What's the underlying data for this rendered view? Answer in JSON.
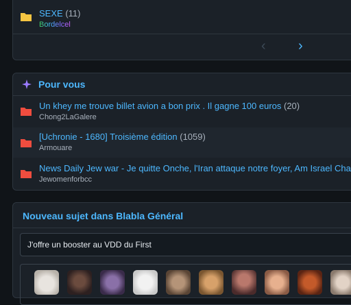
{
  "forum_list": {
    "last_item": {
      "title": "SEXE",
      "count": "(11)",
      "author": "Bordelcel"
    },
    "pager": {
      "prev_icon": "chevron-left-icon",
      "next_icon": "chevron-right-icon"
    }
  },
  "for_you": {
    "title": "Pour vous",
    "icon": "sparkle-icon",
    "topics": [
      {
        "title": "Un khey me trouve billet avion a bon prix . Il gagne 100 euros",
        "count": "(20)",
        "author": "Chong2LaGalere"
      },
      {
        "title": "[Uchronie - 1680] Troisième édition",
        "count": "(1059)",
        "author": "Armouare"
      },
      {
        "title": "News Daily Jew war - Je quitte Onche, l'Iran attaque notre foyer, Am Israel Chai -",
        "count": "",
        "author": "Jewomenforbcc"
      }
    ]
  },
  "new_topic": {
    "title": "Nouveau sujet dans Blabla Général",
    "subject_value": "J'offre un booster au VDD du First"
  },
  "colors": {
    "accent": "#4db8ff",
    "folder_yellow": "#f5c542",
    "folder_red": "#f04d3f",
    "sparkle": "#9b7bff"
  }
}
